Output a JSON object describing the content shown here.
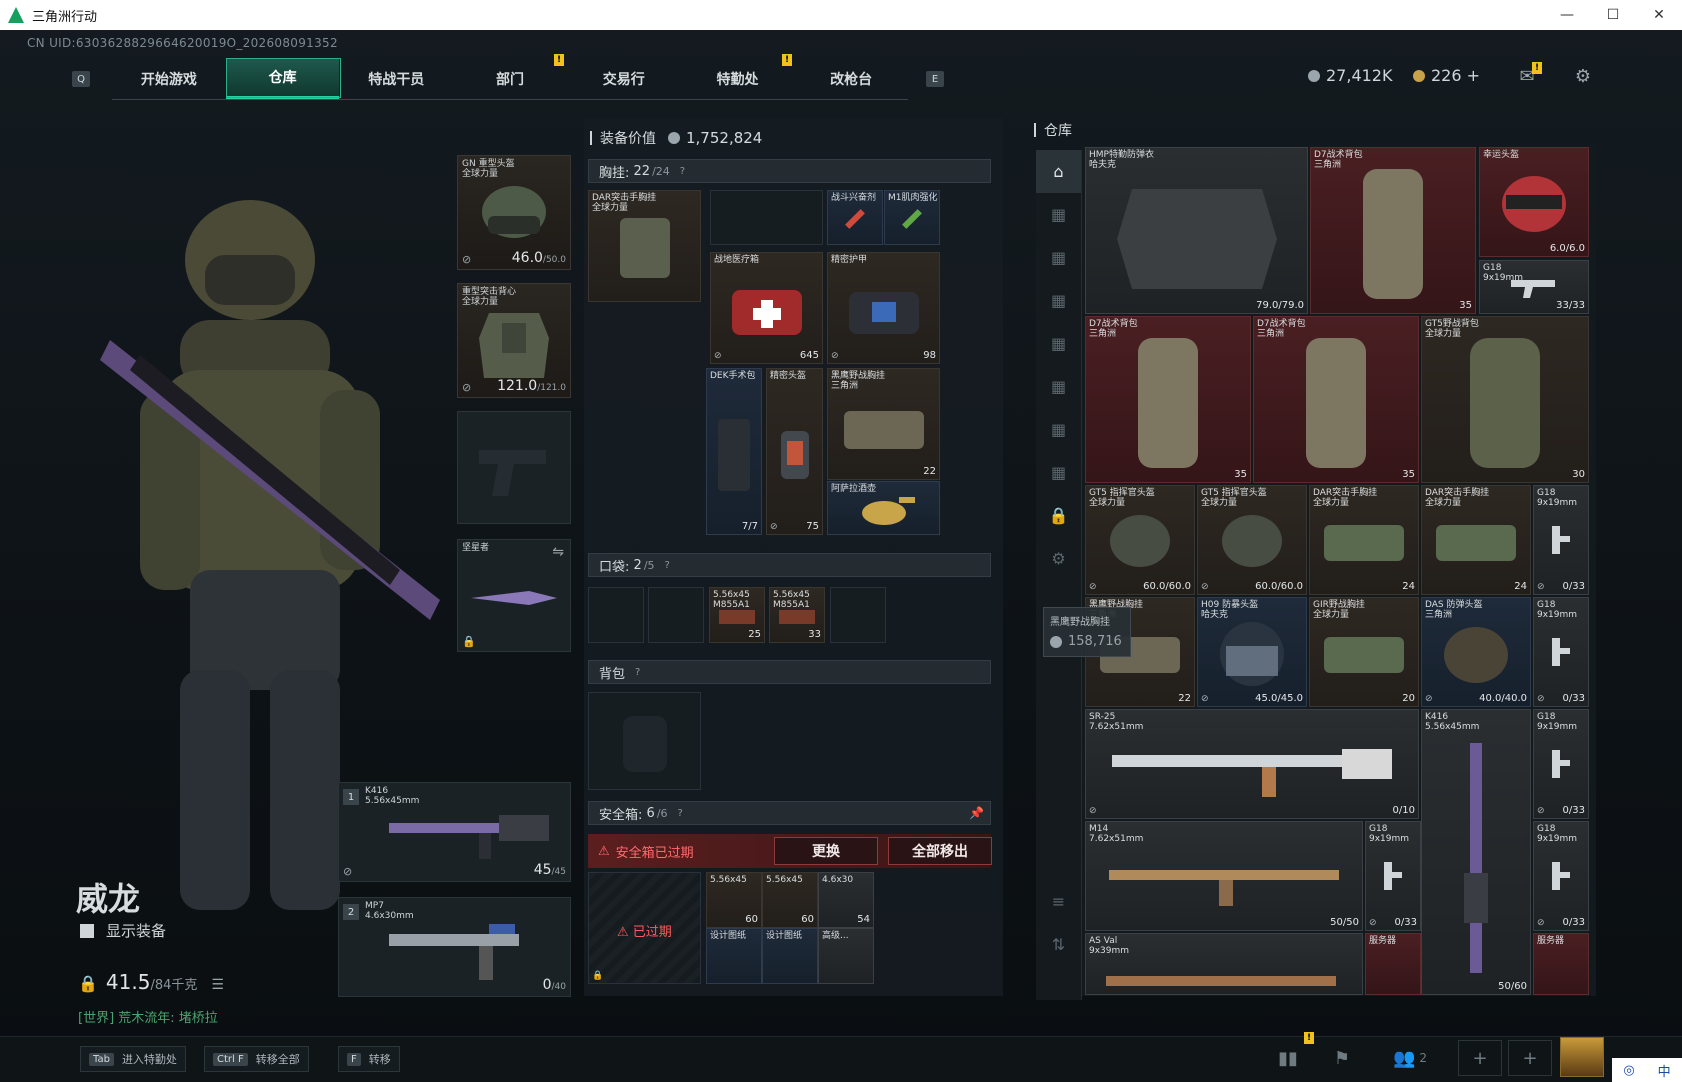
{
  "window": {
    "title": "三角洲行动"
  },
  "uid": "CN UID:6303628829664620019O_202608091352",
  "nav": {
    "key_left": "Q",
    "key_right": "E",
    "tabs": [
      "开始游戏",
      "仓库",
      "特战干员",
      "部门",
      "交易行",
      "特勤处",
      "改枪台"
    ],
    "active": "仓库"
  },
  "currency": {
    "primary": "27,412K",
    "secondary": "226 +"
  },
  "operator": {
    "name": "威龙",
    "show_equipment": "显示装备",
    "weight": "41.5",
    "weight_max": "/84千克"
  },
  "chat": "[世界] 荒木流年: 堵桥拉",
  "gear": {
    "helmet": {
      "label": "GN 重型头盔\n全球力量",
      "durability": "46.0",
      "max": "/50.0"
    },
    "armor": {
      "label": "重型突击背心\n全球力量",
      "durability": "121.0",
      "max": "/121.0"
    },
    "melee": {
      "label": "坚星者"
    },
    "weapon1": {
      "index": "1",
      "name": "K416",
      "ammo_type": "5.56x45mm",
      "ammo": "45",
      "ammo_max": "/45"
    },
    "weapon2": {
      "index": "2",
      "name": "MP7",
      "ammo_type": "4.6x30mm",
      "ammo": "0",
      "ammo_max": "/40"
    }
  },
  "equipment": {
    "value_label": "装备价值",
    "value": "1,752,824",
    "rig": {
      "label": "胸挂:",
      "count": "22",
      "cap": "/24",
      "help": "?"
    },
    "rig_item": "DAR突击手胸挂\n全球力量",
    "rig_cells": [
      {
        "label": "战斗兴奋剂"
      },
      {
        "label": "M1肌肉强化"
      },
      {
        "label": "战地医疗箱",
        "val": "645"
      },
      {
        "label": "精密护甲",
        "val": "98"
      },
      {
        "label": "DEK手术包",
        "val": "7/7"
      },
      {
        "label": "精密头盔",
        "val": "75"
      },
      {
        "label": "黑鹰野战胸挂\n三角洲",
        "val": "22"
      },
      {
        "label": "阿萨拉酒壶"
      }
    ],
    "pocket": {
      "label": "口袋:",
      "count": "2",
      "cap": "/5",
      "help": "?"
    },
    "pocket_cells": [
      {
        "label": "5.56x45\nM855A1",
        "val": "25"
      },
      {
        "label": "5.56x45\nM855A1",
        "val": "33"
      }
    ],
    "backpack": {
      "label": "背包",
      "help": "?"
    },
    "safe": {
      "label": "安全箱:",
      "count": "6",
      "cap": "/6",
      "help": "?",
      "expired": "安全箱已过期",
      "replace": "更换",
      "move_all": "全部移出",
      "expired_tag": "已过期"
    },
    "safe_cells": [
      {
        "label": "5.56x45",
        "val": "60"
      },
      {
        "label": "5.56x45",
        "val": "60"
      },
      {
        "label": "4.6x30",
        "val": "54"
      },
      {
        "label": "设计图纸"
      },
      {
        "label": "设计图纸"
      },
      {
        "label": "高级..."
      }
    ]
  },
  "warehouse": {
    "title": "仓库",
    "items": [
      {
        "label": "HMP特勤防弹衣\n哈夫克",
        "val": "79.0/79.0"
      },
      {
        "label": "D7战术背包\n三角洲",
        "val": "35"
      },
      {
        "label": "幸运头盔",
        "val": "6.0/6.0"
      },
      {
        "label": "G18\n9x19mm",
        "val": "33/33"
      },
      {
        "label": "D7战术背包\n三角洲",
        "val": "35"
      },
      {
        "label": "D7战术背包\n三角洲",
        "val": "35"
      },
      {
        "label": "GT5野战背包\n全球力量",
        "val": "30"
      },
      {
        "label": "GT5 指挥官头盔\n全球力量",
        "val": "60.0/60.0"
      },
      {
        "label": "GT5 指挥官头盔\n全球力量",
        "val": "60.0/60.0"
      },
      {
        "label": "DAR突击手胸挂\n全球力量",
        "val": "24"
      },
      {
        "label": "DAR突击手胸挂\n全球力量",
        "val": "24"
      },
      {
        "label": "G18\n9x19mm",
        "val": "0/33"
      },
      {
        "label": "黑鹰野战胸挂\n三角洲",
        "val": "22"
      },
      {
        "label": "H09 防暴头盔\n哈夫克",
        "val": "45.0/45.0"
      },
      {
        "label": "GIR野战胸挂\n全球力量",
        "val": "20"
      },
      {
        "label": "DAS 防弹头盔\n三角洲",
        "val": "40.0/40.0"
      },
      {
        "label": "G18\n9x19mm",
        "val": "0/33"
      },
      {
        "label": "SR-25\n7.62x51mm",
        "val": "0/10"
      },
      {
        "label": "K416\n5.56x45mm",
        "val": "50/60"
      },
      {
        "label": "G18\n9x19mm",
        "val": "0/33"
      },
      {
        "label": "M14\n7.62x51mm",
        "val": "50/50"
      },
      {
        "label": "G18\n9x19mm",
        "val": "0/33"
      },
      {
        "label": "G18\n9x19mm",
        "val": "0/33"
      },
      {
        "label": "AS Val\n9x39mm",
        "val": ""
      },
      {
        "label": "服务器",
        "val": ""
      },
      {
        "label": "服务器",
        "val": ""
      }
    ],
    "tooltip": {
      "label": "黑鹰野战胸挂",
      "value": "158,716"
    }
  },
  "bottom": {
    "hints": [
      {
        "key": "Tab",
        "label": "进入特勤处"
      },
      {
        "key": "Ctrl F",
        "label": "转移全部"
      },
      {
        "key": "F",
        "label": "转移"
      }
    ],
    "squad_count": "2",
    "ime": "中"
  },
  "colors": {
    "accent": "#27d1a0",
    "danger": "#e04040",
    "rare_red": "#4a1f22",
    "warn": "#f1c21b"
  }
}
